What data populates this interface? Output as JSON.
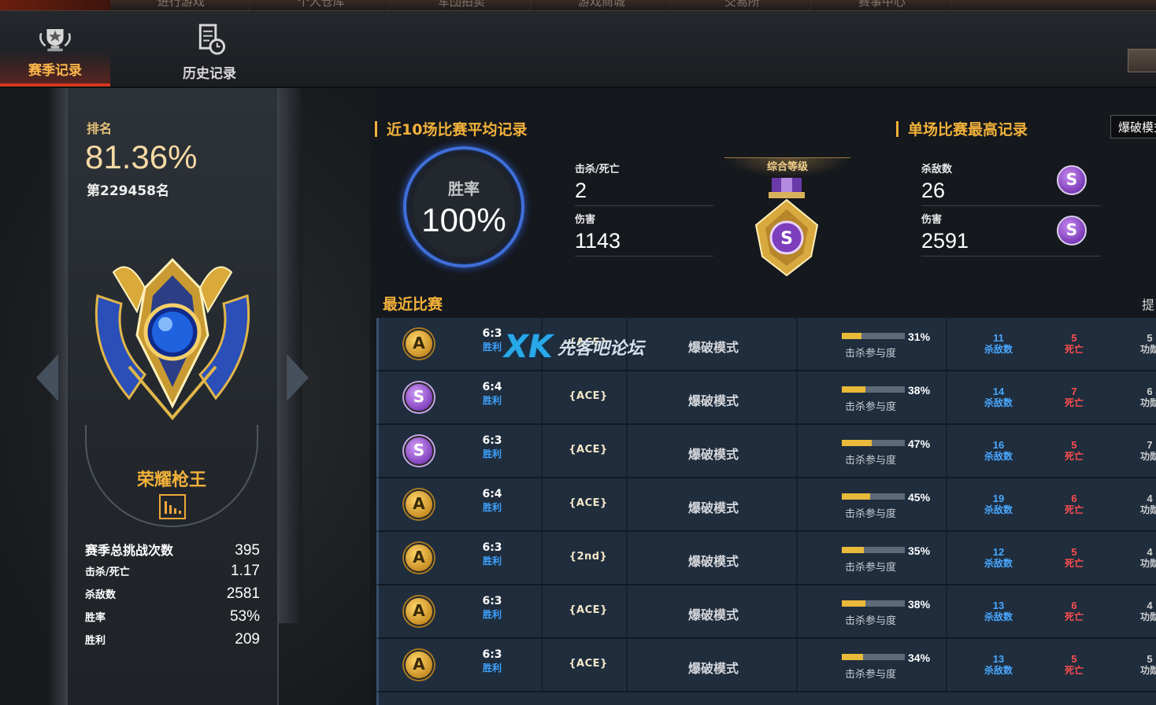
{
  "top_nav": [
    "进行游戏",
    "个人仓库",
    "军団拍卖",
    "游戏商城",
    "交易所",
    "赛事中心"
  ],
  "tabs": [
    {
      "label": "赛季记录",
      "icon": "trophy-icon",
      "active": true
    },
    {
      "label": "历史记录",
      "icon": "history-icon",
      "active": false
    }
  ],
  "rank": {
    "label": "排名",
    "percent": "81.36%",
    "position": "第229458名",
    "title": "荣耀枪王",
    "stats": [
      {
        "key": "赛季总挑战次数",
        "value": "395"
      },
      {
        "key": "击杀/死亡",
        "value": "1.17"
      },
      {
        "key": "杀敌数",
        "value": "2581"
      },
      {
        "key": "胜率",
        "value": "53%"
      },
      {
        "key": "胜利",
        "value": "209"
      }
    ]
  },
  "avg_section": {
    "title": "近10场比赛平均记录",
    "winrate_label": "胜率",
    "winrate_value": "100%",
    "kd_label": "击杀/死亡",
    "kd_value": "2",
    "damage_label": "伤害",
    "damage_value": "1143",
    "grade_label": "综合等级",
    "grade": "S"
  },
  "best_section": {
    "title": "单场比赛最高记录",
    "mode_select": "爆破模式",
    "kills_label": "杀敌数",
    "kills_value": "26",
    "kills_grade": "S",
    "damage_label": "伤害",
    "damage_value": "2591",
    "damage_grade": "S"
  },
  "recent": {
    "title": "最近比赛",
    "cut_hint": "提",
    "kp_label": "击杀参与度",
    "kill_label": "杀敌数",
    "death_label": "死亡",
    "assist_label": "功勋",
    "matches": [
      {
        "grade": "A",
        "score": "6:3",
        "result": "胜利",
        "badge": "{ACE}",
        "mode": "爆破模式",
        "kp": "31%",
        "kp_value": 31,
        "kills": "11",
        "deaths": "5",
        "assists": "5"
      },
      {
        "grade": "S",
        "score": "6:4",
        "result": "胜利",
        "badge": "{ACE}",
        "mode": "爆破模式",
        "kp": "38%",
        "kp_value": 38,
        "kills": "14",
        "deaths": "7",
        "assists": "6"
      },
      {
        "grade": "S",
        "score": "6:3",
        "result": "胜利",
        "badge": "{ACE}",
        "mode": "爆破模式",
        "kp": "47%",
        "kp_value": 47,
        "kills": "16",
        "deaths": "5",
        "assists": "7"
      },
      {
        "grade": "A",
        "score": "6:4",
        "result": "胜利",
        "badge": "{ACE}",
        "mode": "爆破模式",
        "kp": "45%",
        "kp_value": 45,
        "kills": "19",
        "deaths": "6",
        "assists": "4"
      },
      {
        "grade": "A",
        "score": "6:3",
        "result": "胜利",
        "badge": "{2nd}",
        "mode": "爆破模式",
        "kp": "35%",
        "kp_value": 35,
        "kills": "12",
        "deaths": "5",
        "assists": "4"
      },
      {
        "grade": "A",
        "score": "6:3",
        "result": "胜利",
        "badge": "{ACE}",
        "mode": "爆破模式",
        "kp": "38%",
        "kp_value": 38,
        "kills": "13",
        "deaths": "6",
        "assists": "4"
      },
      {
        "grade": "A",
        "score": "6:3",
        "result": "胜利",
        "badge": "{ACE}",
        "mode": "爆破模式",
        "kp": "34%",
        "kp_value": 34,
        "kills": "13",
        "deaths": "5",
        "assists": "5"
      }
    ]
  },
  "watermark": {
    "logo": "XK",
    "text": "先客吧论坛"
  },
  "colors": {
    "accent_gold": "#f1b13a",
    "win_blue": "#3fa3ff",
    "death_red": "#ff4e4e",
    "ring_blue": "#3f6fd9",
    "grade_purple": "#7d3ebc"
  }
}
